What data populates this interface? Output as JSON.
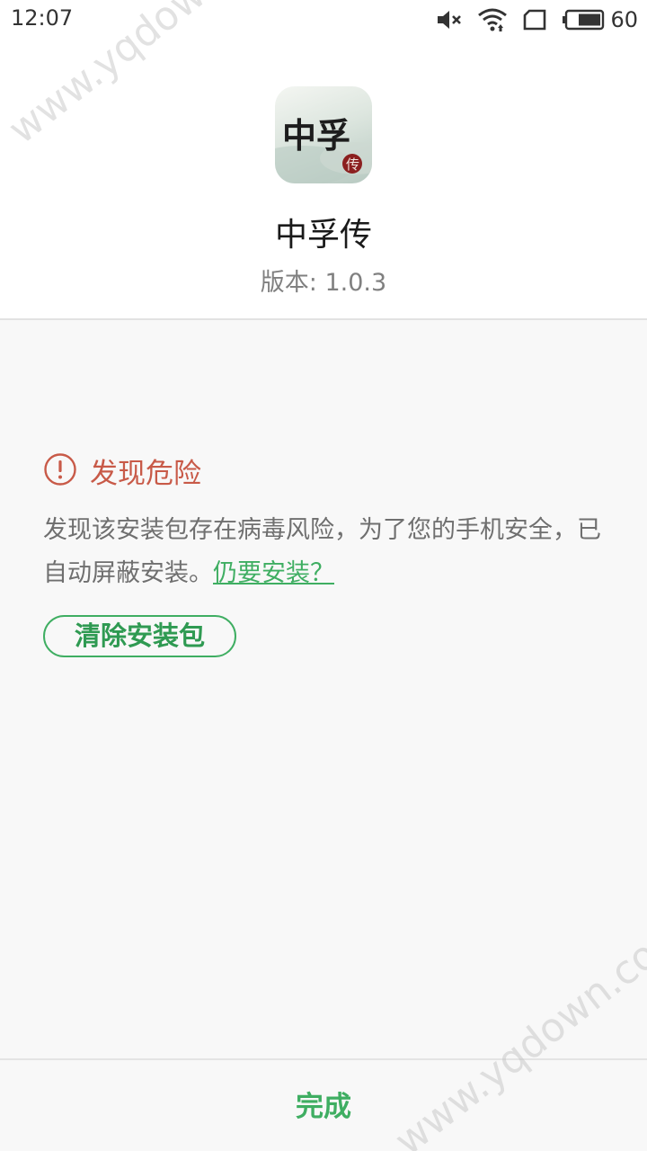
{
  "status_bar": {
    "time": "12:07",
    "battery_level": "60",
    "icons": [
      "mute-icon",
      "wifi-icon",
      "screen-rotate-icon",
      "battery-icon"
    ]
  },
  "app": {
    "name": "中孚传",
    "version_label": "版本: 1.0.3",
    "icon_text": "中孚",
    "icon_seal_text": "传"
  },
  "warning": {
    "title": "发现危险",
    "message": "发现该安装包存在病毒风险，为了您的手机安全，已自动屏蔽安装。",
    "link_text": "仍要安装？",
    "clear_button_label": "清除安装包"
  },
  "footer": {
    "done_label": "完成"
  },
  "watermark": {
    "text": "www.yqdown.com"
  },
  "colors": {
    "accent_green": "#3fae62",
    "danger_red": "#c85a48"
  }
}
